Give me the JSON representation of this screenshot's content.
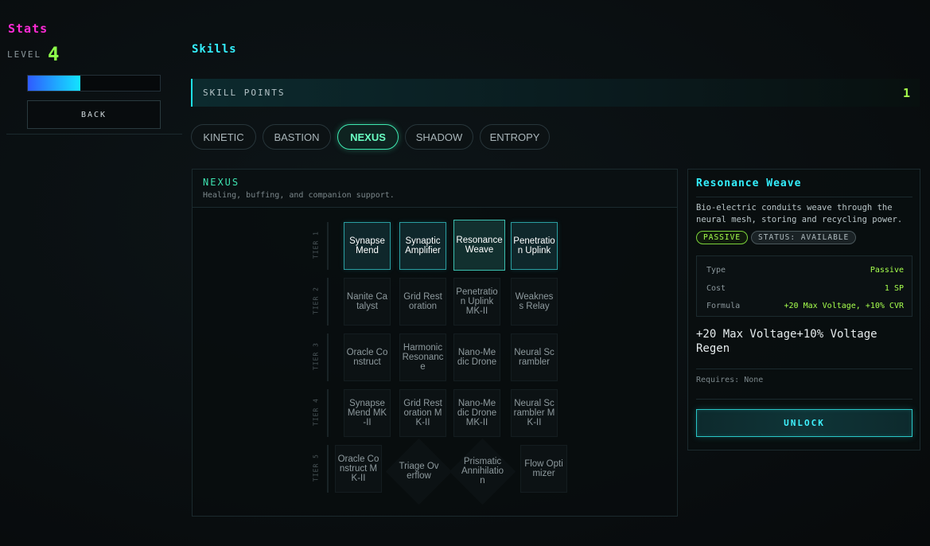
{
  "sidebar": {
    "title": "Stats",
    "level_label": "LEVEL",
    "level_value": "4",
    "xp_progress": 0.4,
    "back_label": "BACK"
  },
  "skills": {
    "title": "Skills",
    "points_label": "SKILL POINTS",
    "points_value": "1"
  },
  "tabs": [
    {
      "label": "KINETIC",
      "active": false
    },
    {
      "label": "BASTION",
      "active": false
    },
    {
      "label": "NEXUS",
      "active": true
    },
    {
      "label": "SHADOW",
      "active": false
    },
    {
      "label": "ENTROPY",
      "active": false
    }
  ],
  "tree": {
    "title": "NEXUS",
    "subtitle": "Healing, buffing, and companion support.",
    "tiers": [
      {
        "label": "TIER 1",
        "nodes": [
          {
            "name": "Synapse Mend",
            "state": "available",
            "shape": "square"
          },
          {
            "name": "Synaptic Amplifier",
            "state": "available",
            "shape": "square"
          },
          {
            "name": "Resonance Weave",
            "state": "selected",
            "shape": "square"
          },
          {
            "name": "Penetration Uplink",
            "state": "available",
            "shape": "square"
          }
        ]
      },
      {
        "label": "TIER 2",
        "nodes": [
          {
            "name": "Nanite Catalyst",
            "state": "locked",
            "shape": "square"
          },
          {
            "name": "Grid Restoration",
            "state": "locked",
            "shape": "square"
          },
          {
            "name": "Penetration Uplink MK-II",
            "state": "locked",
            "shape": "square"
          },
          {
            "name": "Weakness Relay",
            "state": "locked",
            "shape": "square"
          }
        ]
      },
      {
        "label": "TIER 3",
        "nodes": [
          {
            "name": "Oracle Construct",
            "state": "locked",
            "shape": "square"
          },
          {
            "name": "Harmonic Resonance",
            "state": "locked",
            "shape": "square"
          },
          {
            "name": "Nano-Medic Drone",
            "state": "locked",
            "shape": "square"
          },
          {
            "name": "Neural Scrambler",
            "state": "locked",
            "shape": "square"
          }
        ]
      },
      {
        "label": "TIER 4",
        "nodes": [
          {
            "name": "Synapse Mend MK-II",
            "state": "locked",
            "shape": "square"
          },
          {
            "name": "Grid Restoration MK-II",
            "state": "locked",
            "shape": "square"
          },
          {
            "name": "Nano-Medic Drone MK-II",
            "state": "locked",
            "shape": "square"
          },
          {
            "name": "Neural Scrambler MK-II",
            "state": "locked",
            "shape": "square"
          }
        ]
      },
      {
        "label": "TIER 5",
        "nodes": [
          {
            "name": "Oracle Construct MK-II",
            "state": "locked",
            "shape": "square"
          },
          {
            "name": "Triage Overflow",
            "state": "locked",
            "shape": "diamond"
          },
          {
            "name": "Prismatic Annihilation",
            "state": "locked",
            "shape": "diamond"
          },
          {
            "name": "Flow Optimizer",
            "state": "locked",
            "shape": "square"
          }
        ]
      }
    ]
  },
  "detail": {
    "title": "Resonance Weave",
    "description": "Bio-electric conduits weave through the neural mesh, storing and recycling power.",
    "badge_type": "PASSIVE",
    "badge_status": "STATUS: AVAILABLE",
    "rows": [
      {
        "key": "Type",
        "value": "Passive"
      },
      {
        "key": "Cost",
        "value": "1 SP"
      },
      {
        "key": "Formula",
        "value": "+20 Max Voltage, +10% CVR"
      }
    ],
    "effect": "+20 Max Voltage+10% Voltage Regen",
    "requires": "Requires: None",
    "unlock_label": "UNLOCK"
  },
  "colors": {
    "stats_title": "#ff2bd6",
    "accent_cyan": "#34f0ff",
    "accent_green": "#a6ff4d",
    "nexus_teal": "#3de2b0"
  }
}
